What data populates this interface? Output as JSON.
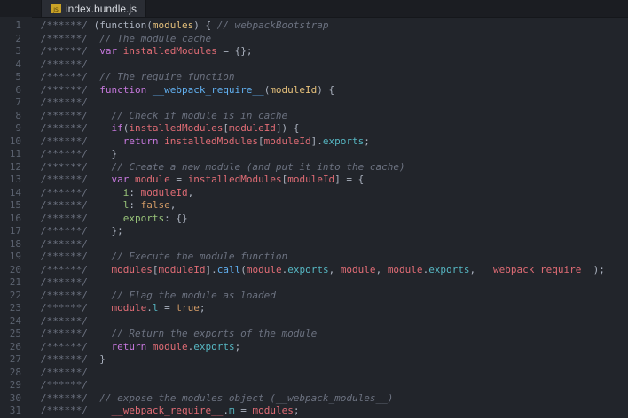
{
  "tab": {
    "label": "index.bundle.js",
    "icon": "js-file-icon",
    "icon_text": "JS"
  },
  "lines": [
    {
      "n": "1",
      "tokens": [
        [
          "cm",
          "/******/ "
        ],
        [
          "pu",
          "(function("
        ],
        [
          "pr",
          "modules"
        ],
        [
          "pu",
          ") { "
        ],
        [
          "cm",
          "// webpackBootstrap"
        ]
      ]
    },
    {
      "n": "2",
      "tokens": [
        [
          "cm",
          "/******/  "
        ],
        [
          "cm",
          "// The module cache"
        ]
      ]
    },
    {
      "n": "3",
      "tokens": [
        [
          "cm",
          "/******/  "
        ],
        [
          "kw",
          "var "
        ],
        [
          "vr",
          "installedModules"
        ],
        [
          "pu",
          " = {};"
        ]
      ]
    },
    {
      "n": "4",
      "tokens": [
        [
          "cm",
          "/******/"
        ]
      ]
    },
    {
      "n": "5",
      "tokens": [
        [
          "cm",
          "/******/  "
        ],
        [
          "cm",
          "// The require function"
        ]
      ]
    },
    {
      "n": "6",
      "tokens": [
        [
          "cm",
          "/******/  "
        ],
        [
          "kw",
          "function "
        ],
        [
          "fn",
          "__webpack_require__"
        ],
        [
          "pu",
          "("
        ],
        [
          "pr",
          "moduleId"
        ],
        [
          "pu",
          ") {"
        ]
      ]
    },
    {
      "n": "7",
      "tokens": [
        [
          "cm",
          "/******/"
        ]
      ]
    },
    {
      "n": "8",
      "tokens": [
        [
          "cm",
          "/******/    "
        ],
        [
          "cm",
          "// Check if module is in cache"
        ]
      ]
    },
    {
      "n": "9",
      "tokens": [
        [
          "cm",
          "/******/    "
        ],
        [
          "kw",
          "if"
        ],
        [
          "pu",
          "("
        ],
        [
          "vr",
          "installedModules"
        ],
        [
          "pu",
          "["
        ],
        [
          "vr",
          "moduleId"
        ],
        [
          "pu",
          "]) {"
        ]
      ]
    },
    {
      "n": "10",
      "tokens": [
        [
          "cm",
          "/******/      "
        ],
        [
          "kw",
          "return "
        ],
        [
          "vr",
          "installedModules"
        ],
        [
          "pu",
          "["
        ],
        [
          "vr",
          "moduleId"
        ],
        [
          "pu",
          "]."
        ],
        [
          "ob",
          "exports"
        ],
        [
          "pu",
          ";"
        ]
      ]
    },
    {
      "n": "11",
      "tokens": [
        [
          "cm",
          "/******/    "
        ],
        [
          "pu",
          "}"
        ]
      ]
    },
    {
      "n": "12",
      "tokens": [
        [
          "cm",
          "/******/    "
        ],
        [
          "cm",
          "// Create a new module (and put it into the cache)"
        ]
      ]
    },
    {
      "n": "13",
      "tokens": [
        [
          "cm",
          "/******/    "
        ],
        [
          "kw",
          "var "
        ],
        [
          "vr",
          "module"
        ],
        [
          "pu",
          " = "
        ],
        [
          "vr",
          "installedModules"
        ],
        [
          "pu",
          "["
        ],
        [
          "vr",
          "moduleId"
        ],
        [
          "pu",
          "] = {"
        ]
      ]
    },
    {
      "n": "14",
      "tokens": [
        [
          "cm",
          "/******/      "
        ],
        [
          "ky",
          "i"
        ],
        [
          "pu",
          ": "
        ],
        [
          "vr",
          "moduleId"
        ],
        [
          "pu",
          ","
        ]
      ]
    },
    {
      "n": "15",
      "tokens": [
        [
          "cm",
          "/******/      "
        ],
        [
          "ky",
          "l"
        ],
        [
          "pu",
          ": "
        ],
        [
          "bo",
          "false"
        ],
        [
          "pu",
          ","
        ]
      ]
    },
    {
      "n": "16",
      "tokens": [
        [
          "cm",
          "/******/      "
        ],
        [
          "ky",
          "exports"
        ],
        [
          "pu",
          ": {}"
        ]
      ]
    },
    {
      "n": "17",
      "tokens": [
        [
          "cm",
          "/******/    "
        ],
        [
          "pu",
          "};"
        ]
      ]
    },
    {
      "n": "18",
      "tokens": [
        [
          "cm",
          "/******/"
        ]
      ]
    },
    {
      "n": "19",
      "tokens": [
        [
          "cm",
          "/******/    "
        ],
        [
          "cm",
          "// Execute the module function"
        ]
      ]
    },
    {
      "n": "20",
      "tokens": [
        [
          "cm",
          "/******/    "
        ],
        [
          "vr",
          "modules"
        ],
        [
          "pu",
          "["
        ],
        [
          "vr",
          "moduleId"
        ],
        [
          "pu",
          "]."
        ],
        [
          "fn",
          "call"
        ],
        [
          "pu",
          "("
        ],
        [
          "vr",
          "module"
        ],
        [
          "pu",
          "."
        ],
        [
          "ob",
          "exports"
        ],
        [
          "pu",
          ", "
        ],
        [
          "vr",
          "module"
        ],
        [
          "pu",
          ", "
        ],
        [
          "vr",
          "module"
        ],
        [
          "pu",
          "."
        ],
        [
          "ob",
          "exports"
        ],
        [
          "pu",
          ", "
        ],
        [
          "vr",
          "__webpack_require__"
        ],
        [
          "pu",
          ");"
        ]
      ]
    },
    {
      "n": "21",
      "tokens": [
        [
          "cm",
          "/******/"
        ]
      ]
    },
    {
      "n": "22",
      "tokens": [
        [
          "cm",
          "/******/    "
        ],
        [
          "cm",
          "// Flag the module as loaded"
        ]
      ]
    },
    {
      "n": "23",
      "tokens": [
        [
          "cm",
          "/******/    "
        ],
        [
          "vr",
          "module"
        ],
        [
          "pu",
          "."
        ],
        [
          "ob",
          "l"
        ],
        [
          "pu",
          " = "
        ],
        [
          "bo",
          "true"
        ],
        [
          "pu",
          ";"
        ]
      ]
    },
    {
      "n": "24",
      "tokens": [
        [
          "cm",
          "/******/"
        ]
      ]
    },
    {
      "n": "25",
      "tokens": [
        [
          "cm",
          "/******/    "
        ],
        [
          "cm",
          "// Return the exports of the module"
        ]
      ]
    },
    {
      "n": "26",
      "tokens": [
        [
          "cm",
          "/******/    "
        ],
        [
          "kw",
          "return "
        ],
        [
          "vr",
          "module"
        ],
        [
          "pu",
          "."
        ],
        [
          "ob",
          "exports"
        ],
        [
          "pu",
          ";"
        ]
      ]
    },
    {
      "n": "27",
      "tokens": [
        [
          "cm",
          "/******/  "
        ],
        [
          "pu",
          "}"
        ]
      ]
    },
    {
      "n": "28",
      "tokens": [
        [
          "cm",
          "/******/"
        ]
      ]
    },
    {
      "n": "29",
      "tokens": [
        [
          "cm",
          "/******/"
        ]
      ]
    },
    {
      "n": "30",
      "tokens": [
        [
          "cm",
          "/******/  "
        ],
        [
          "cm",
          "// expose the modules object (__webpack_modules__)"
        ]
      ]
    },
    {
      "n": "31",
      "tokens": [
        [
          "cm",
          "/******/    "
        ],
        [
          "vr",
          "__webpack_require__"
        ],
        [
          "pu",
          "."
        ],
        [
          "ob",
          "m"
        ],
        [
          "pu",
          " = "
        ],
        [
          "vr",
          "modules"
        ],
        [
          "pu",
          ";"
        ]
      ]
    }
  ]
}
